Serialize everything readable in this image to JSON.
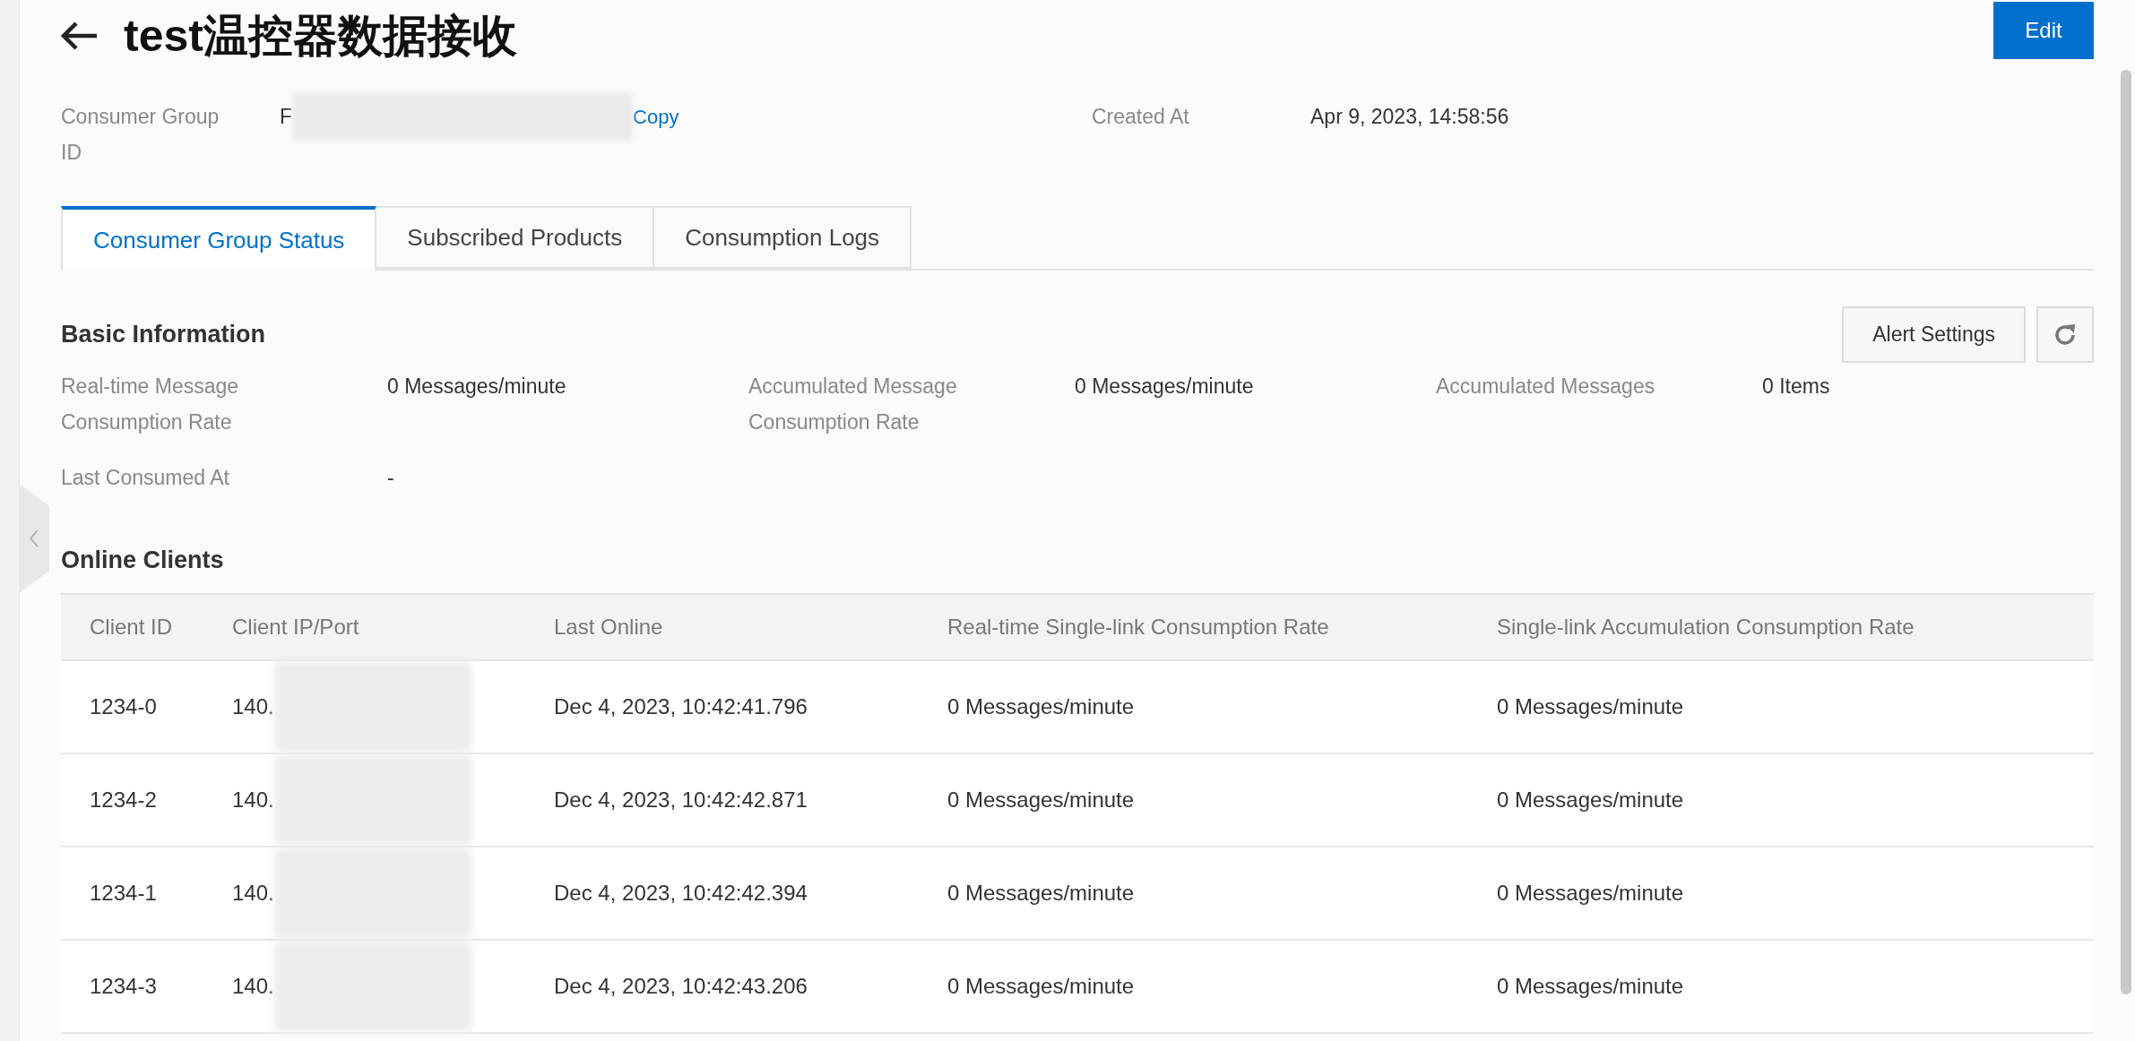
{
  "header": {
    "title": "test温控器数据接收",
    "edit_button": "Edit"
  },
  "details": [
    {
      "label": "Consumer Group ID",
      "value": "F",
      "redacted": true,
      "link": "Copy"
    },
    {
      "label": "Created At",
      "value": "Apr 9, 2023, 14:58:56",
      "redacted": false
    }
  ],
  "tabs": [
    {
      "label": "Consumer Group Status",
      "selected": true
    },
    {
      "label": "Subscribed Products",
      "selected": false
    },
    {
      "label": "Consumption Logs",
      "selected": false
    }
  ],
  "basic_information": {
    "title": "Basic Information",
    "alert_button": "Alert Settings",
    "fields": [
      {
        "label": "Real-time Message Consumption Rate",
        "value": "0 Messages/minute"
      },
      {
        "label": "Accumulated Message Consumption Rate",
        "value": "0 Messages/minute"
      },
      {
        "label": "Accumulated Messages",
        "value": "0 Items"
      },
      {
        "label": "Last Consumed At",
        "value": "-"
      }
    ]
  },
  "online_clients": {
    "title": "Online Clients",
    "columns": [
      "Client ID",
      "Client IP/Port",
      "Last Online",
      "Real-time Single-link Consumption Rate",
      "Single-link Accumulation Consumption Rate"
    ],
    "rows": [
      [
        "1234-0",
        "140.",
        "Dec 4, 2023, 10:42:41.796",
        "0 Messages/minute",
        "0 Messages/minute"
      ],
      [
        "1234-2",
        "140.",
        "Dec 4, 2023, 10:42:42.871",
        "0 Messages/minute",
        "0 Messages/minute"
      ],
      [
        "1234-1",
        "140.",
        "Dec 4, 2023, 10:42:42.394",
        "0 Messages/minute",
        "0 Messages/minute"
      ],
      [
        "1234-3",
        "140.",
        "Dec 4, 2023, 10:42:43.206",
        "0 Messages/minute",
        "0 Messages/minute"
      ]
    ]
  }
}
